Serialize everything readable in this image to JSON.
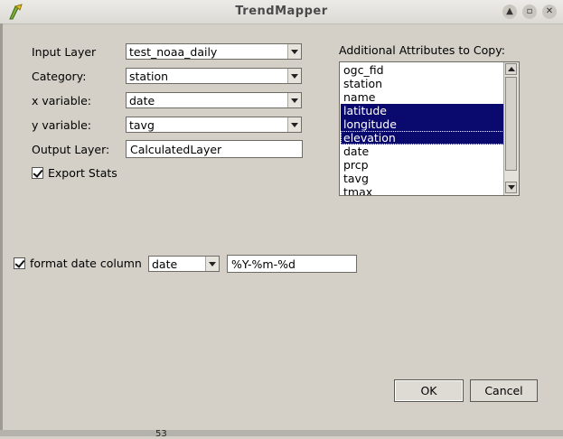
{
  "window": {
    "title": "TrendMapper",
    "controls": [
      "up-icon",
      "maximize-icon",
      "close-icon"
    ]
  },
  "form": {
    "input_layer": {
      "label": "Input Layer",
      "value": "test_noaa_daily"
    },
    "category": {
      "label": "Category:",
      "value": "station"
    },
    "x_variable": {
      "label": "x variable:",
      "value": "date"
    },
    "y_variable": {
      "label": "y variable:",
      "value": "tavg"
    },
    "output_layer": {
      "label": "Output Layer:",
      "value": "CalculatedLayer"
    },
    "export_stats": {
      "label": "Export Stats",
      "checked": true
    }
  },
  "attributes": {
    "label": "Additional Attributes to Copy:",
    "items": [
      {
        "text": "ogc_fid",
        "selected": false
      },
      {
        "text": "station",
        "selected": false
      },
      {
        "text": "name",
        "selected": false
      },
      {
        "text": "latitude",
        "selected": true
      },
      {
        "text": "longitude",
        "selected": true
      },
      {
        "text": "elevation",
        "selected": true
      },
      {
        "text": "date",
        "selected": false
      },
      {
        "text": "prcp",
        "selected": false
      },
      {
        "text": "tavg",
        "selected": false
      },
      {
        "text": "tmax",
        "selected": false
      }
    ]
  },
  "date_format": {
    "label": "format date column",
    "checked": true,
    "column": "date",
    "format": "%Y-%m-%d"
  },
  "buttons": {
    "ok": "OK",
    "cancel": "Cancel"
  },
  "background_peek": "53"
}
